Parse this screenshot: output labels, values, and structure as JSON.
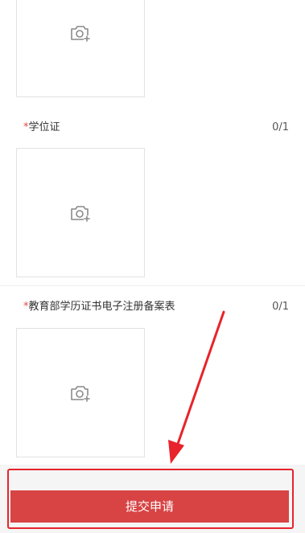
{
  "fields": [
    {
      "label": "学位证",
      "required_mark": "*",
      "count": "0/1",
      "icon": "camera-add-icon"
    },
    {
      "label": "教育部学历证书电子注册备案表",
      "required_mark": "*",
      "count": "0/1",
      "icon": "camera-add-icon"
    }
  ],
  "submit": {
    "label": "提交申请"
  },
  "colors": {
    "accent": "#d84343",
    "annotation": "#e8232b",
    "required": "#e04b4b"
  }
}
